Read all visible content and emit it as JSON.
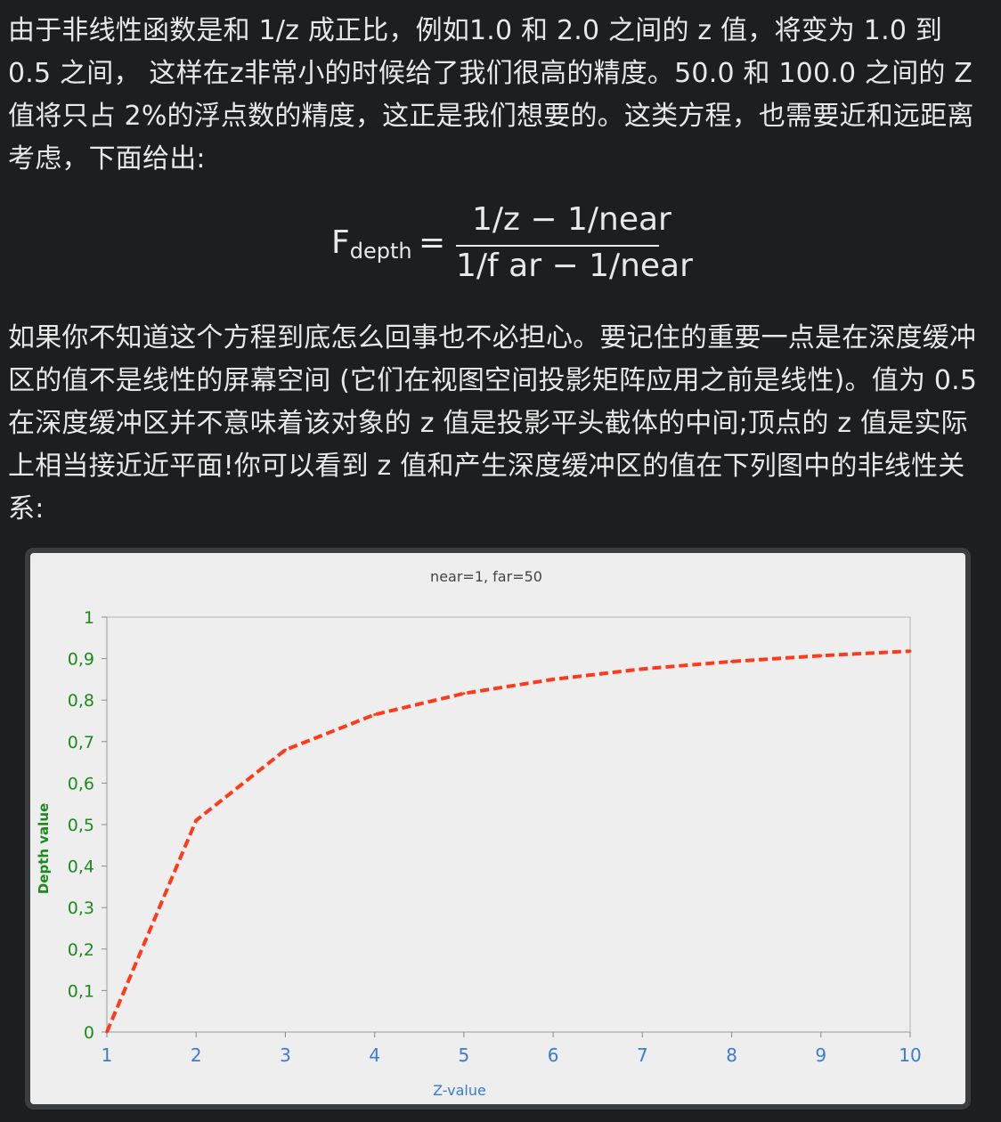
{
  "article": {
    "paragraph1": "由于非线性函数是和 1/z 成正比，例如1.0 和 2.0 之间的 z 值，将变为 1.0 到 0.5 之间， 这样在z非常小的时候给了我们很高的精度。50.0 和 100.0 之间的 Z 值将只占 2%的浮点数的精度，这正是我们想要的。这类方程，也需要近和远距离考虑，下面给出:",
    "formula": {
      "lhs_main": "F",
      "lhs_sub": "depth",
      "equals": "=",
      "numerator": "1/z − 1/near",
      "denominator": "1/f ar − 1/near"
    },
    "paragraph2": "如果你不知道这个方程到底怎么回事也不必担心。要记住的重要一点是在深度缓冲区的值不是线性的屏幕空间 (它们在视图空间投影矩阵应用之前是线性)。值为 0.5 在深度缓冲区并不意味着该对象的 z 值是投影平头截体的中间;顶点的 z 值是实际上相当接近近平面!你可以看到 z 值和产生深度缓冲区的值在下列图中的非线性关系:"
  },
  "chart_data": {
    "type": "line",
    "title": "near=1, far=50",
    "xlabel": "Z-value",
    "ylabel": "Depth value",
    "xlim": [
      1,
      10
    ],
    "ylim": [
      0,
      1
    ],
    "x": [
      1,
      2,
      3,
      4,
      5,
      6,
      7,
      8,
      9,
      10
    ],
    "y_ticks": [
      "0",
      "0,1",
      "0,2",
      "0,3",
      "0,4",
      "0,5",
      "0,6",
      "0,7",
      "0,8",
      "0,9",
      "1"
    ],
    "x_ticks": [
      "1",
      "2",
      "3",
      "4",
      "5",
      "6",
      "7",
      "8",
      "9",
      "10"
    ],
    "series": [
      {
        "values": [
          0,
          0.51,
          0.68,
          0.765,
          0.816,
          0.85,
          0.875,
          0.893,
          0.907,
          0.918
        ],
        "color": "#ff3a1a",
        "style": "dashed"
      }
    ],
    "grid": false,
    "colors": {
      "ytick": "#1e8a1e",
      "xtick": "#3a7bd5",
      "ylabel": "#1e8a1e",
      "xlabel": "#3a7bd5",
      "title": "#444444"
    }
  }
}
